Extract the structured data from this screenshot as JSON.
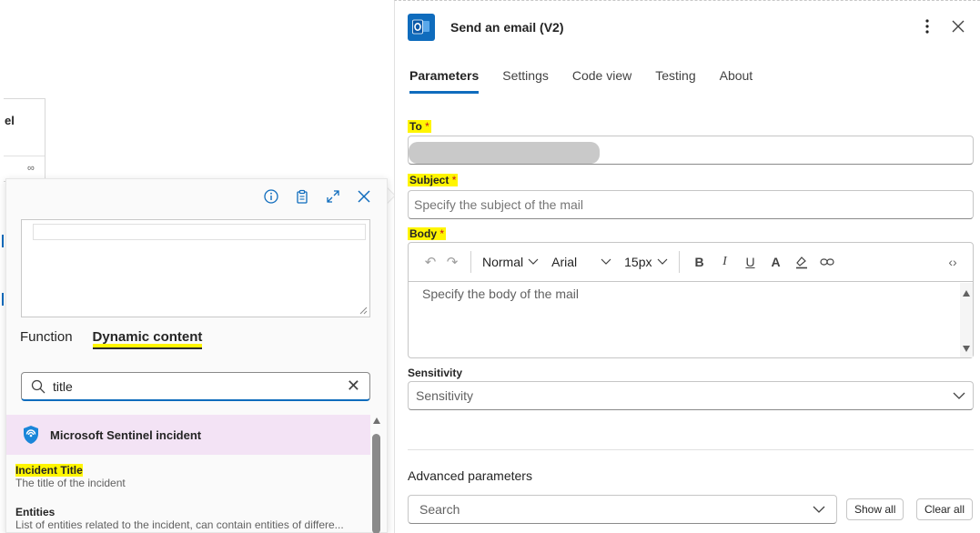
{
  "canvas": {
    "node_title_fragment": "el"
  },
  "popup": {
    "tabs": [
      {
        "label": "Function",
        "active": false
      },
      {
        "label": "Dynamic content",
        "active": true
      }
    ],
    "search": {
      "value": "title",
      "placeholder": ""
    },
    "group": {
      "label": "Microsoft Sentinel incident",
      "icon": "sentinel-shield-icon"
    },
    "results": [
      {
        "title": "Incident Title",
        "description": "The title of the incident"
      },
      {
        "title": "Entities",
        "description": "List of entities related to the incident, can contain entities of differe..."
      }
    ],
    "toolbar_icons": [
      "info-icon",
      "clipboard-icon",
      "expand-icon",
      "close-icon"
    ]
  },
  "panel": {
    "title": "Send an email (V2)",
    "app_icon": "outlook-icon",
    "tabs": [
      {
        "label": "Parameters",
        "active": true
      },
      {
        "label": "Settings",
        "active": false
      },
      {
        "label": "Code view",
        "active": false
      },
      {
        "label": "Testing",
        "active": false
      },
      {
        "label": "About",
        "active": false
      }
    ],
    "to": {
      "label": "To",
      "required_mark": "*",
      "value": ""
    },
    "subject": {
      "label": "Subject",
      "required_mark": "*",
      "placeholder": "Specify the subject of the mail"
    },
    "body": {
      "label": "Body",
      "required_mark": "*",
      "placeholder": "Specify the body of the mail",
      "toolbar": {
        "style": "Normal",
        "font": "Arial",
        "size": "15px"
      }
    },
    "sensitivity": {
      "label": "Sensitivity",
      "value": "Sensitivity"
    },
    "advanced": {
      "label": "Advanced parameters",
      "search_placeholder": "Search",
      "show_all": "Show all",
      "clear_all": "Clear all"
    }
  },
  "colors": {
    "accent": "#0f6cbd",
    "highlight": "#fff500",
    "group_bg": "#f3e3f5",
    "required": "#c50f1f"
  }
}
